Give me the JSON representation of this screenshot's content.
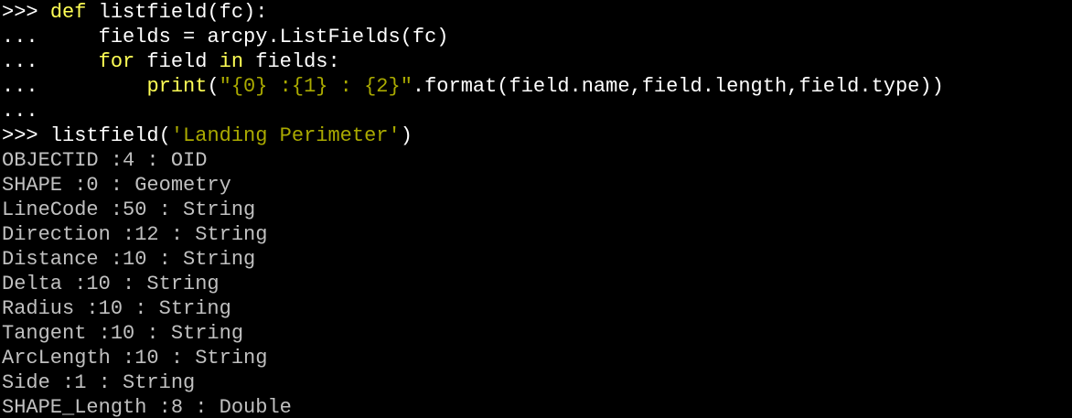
{
  "palette": {
    "background": "#000000",
    "prompt": "#ffffff",
    "keyword": "#ffff55",
    "string": "#aaaa00",
    "output": "#c0c0c0"
  },
  "lines": [
    {
      "kind": "code",
      "tokens": [
        {
          "text": ">>> ",
          "color": "prompt"
        },
        {
          "text": "def",
          "color": "keyword"
        },
        {
          "text": " listfield(fc):",
          "color": "prompt"
        }
      ]
    },
    {
      "kind": "code",
      "tokens": [
        {
          "text": "...     ",
          "color": "prompt"
        },
        {
          "text": "fields = arcpy.ListFields(fc)",
          "color": "prompt"
        }
      ]
    },
    {
      "kind": "code",
      "tokens": [
        {
          "text": "...     ",
          "color": "prompt"
        },
        {
          "text": "for",
          "color": "keyword"
        },
        {
          "text": " field ",
          "color": "prompt"
        },
        {
          "text": "in",
          "color": "keyword"
        },
        {
          "text": " fields:",
          "color": "prompt"
        }
      ]
    },
    {
      "kind": "code",
      "tokens": [
        {
          "text": "...         ",
          "color": "prompt"
        },
        {
          "text": "print",
          "color": "keyword"
        },
        {
          "text": "(",
          "color": "prompt"
        },
        {
          "text": "\"{0} :{1} : {2}\"",
          "color": "string"
        },
        {
          "text": ".format(field.name,field.length,field.type))",
          "color": "prompt"
        }
      ]
    },
    {
      "kind": "code",
      "tokens": [
        {
          "text": "...",
          "color": "prompt"
        }
      ]
    },
    {
      "kind": "code",
      "tokens": [
        {
          "text": ">>> ",
          "color": "prompt"
        },
        {
          "text": "listfield(",
          "color": "prompt"
        },
        {
          "text": "'Landing Perimeter'",
          "color": "string"
        },
        {
          "text": ")",
          "color": "prompt"
        }
      ]
    },
    {
      "kind": "output",
      "tokens": [
        {
          "text": "OBJECTID :4 : OID",
          "color": "output"
        }
      ]
    },
    {
      "kind": "output",
      "tokens": [
        {
          "text": "SHAPE :0 : Geometry",
          "color": "output"
        }
      ]
    },
    {
      "kind": "output",
      "tokens": [
        {
          "text": "LineCode :50 : String",
          "color": "output"
        }
      ]
    },
    {
      "kind": "output",
      "tokens": [
        {
          "text": "Direction :12 : String",
          "color": "output"
        }
      ]
    },
    {
      "kind": "output",
      "tokens": [
        {
          "text": "Distance :10 : String",
          "color": "output"
        }
      ]
    },
    {
      "kind": "output",
      "tokens": [
        {
          "text": "Delta :10 : String",
          "color": "output"
        }
      ]
    },
    {
      "kind": "output",
      "tokens": [
        {
          "text": "Radius :10 : String",
          "color": "output"
        }
      ]
    },
    {
      "kind": "output",
      "tokens": [
        {
          "text": "Tangent :10 : String",
          "color": "output"
        }
      ]
    },
    {
      "kind": "output",
      "tokens": [
        {
          "text": "ArcLength :10 : String",
          "color": "output"
        }
      ]
    },
    {
      "kind": "output",
      "tokens": [
        {
          "text": "Side :1 : String",
          "color": "output"
        }
      ]
    },
    {
      "kind": "output",
      "tokens": [
        {
          "text": "SHAPE_Length :8 : Double",
          "color": "output"
        }
      ]
    }
  ]
}
